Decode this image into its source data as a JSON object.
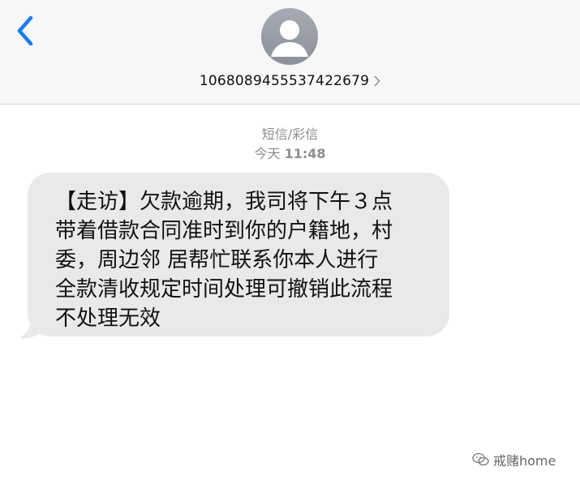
{
  "header": {
    "contact_number": "1068089455537422679"
  },
  "thread": {
    "message_type": "短信/彩信",
    "timestamp_day": "今天",
    "timestamp_time": "11:48"
  },
  "message": {
    "text": "【走访】欠款逾期，我司将下午３点\n带着借款合同准时到你的户籍地，村\n委，周边邻 居帮忙联系你本人进行\n全款清收规定时间处理可撤销此流程\n不处理无效"
  },
  "watermark": {
    "text": "戒赌home"
  },
  "colors": {
    "accent": "#147efb",
    "bubble": "#e9e9eb",
    "header_bg": "#f7f7f7",
    "meta_text": "#8e8e93"
  },
  "icons": {
    "back": "chevron-left-icon",
    "avatar": "person-icon",
    "contact_details": "chevron-right-icon",
    "watermark": "wechat-icon"
  }
}
